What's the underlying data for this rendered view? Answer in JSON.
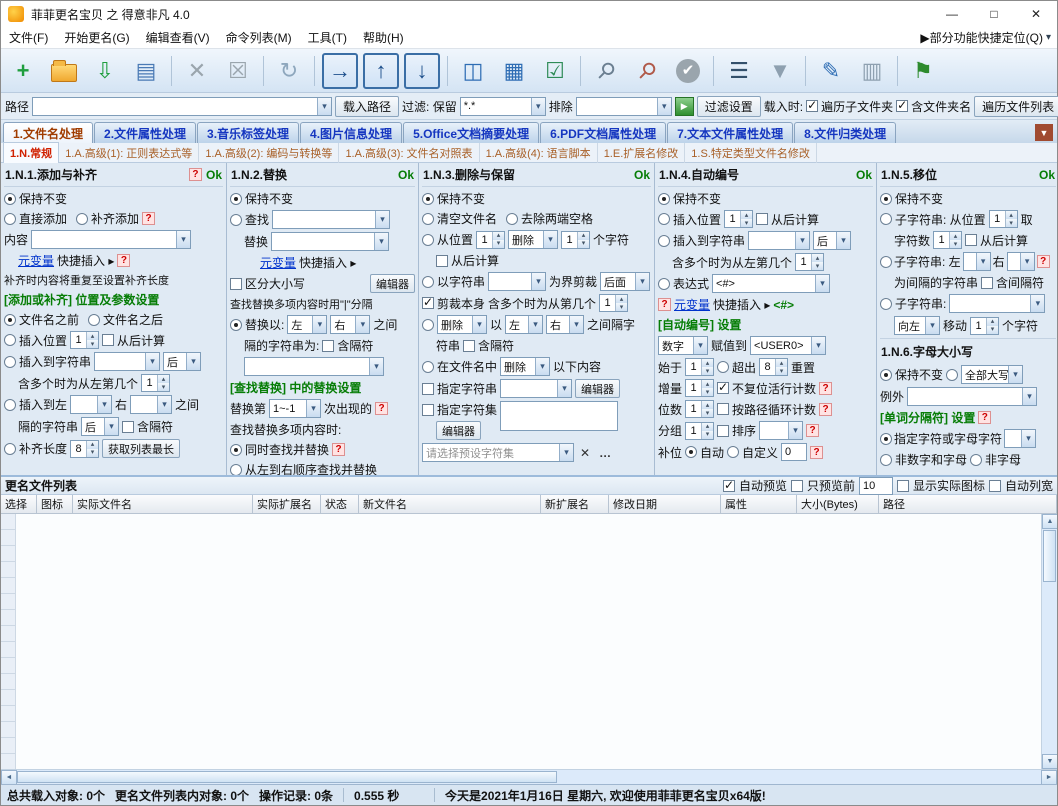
{
  "ui": {
    "q": "?",
    "ok": "Ok",
    "combo_arrow": "▾",
    "spin_up": "▴",
    "spin_down": "▾",
    "up": "▲",
    "down": "▼",
    "left": "◄",
    "right": "►"
  },
  "titlebar": {
    "title": "菲菲更名宝贝 之 得意非凡 4.0",
    "minimize": "—",
    "maximize": "□",
    "close": "✕"
  },
  "menubar": {
    "items": [
      "文件(F)",
      "开始更名(G)",
      "编辑查看(V)",
      "命令列表(M)",
      "工具(T)",
      "帮助(H)"
    ],
    "quick_locate": "▶部分功能快捷定位(Q)",
    "quick_locate_arrow": "▾"
  },
  "toolbar": {
    "icons": [
      {
        "name": "new-list-button",
        "glyph": "+",
        "color": "#1f9e3e",
        "bold": true
      },
      {
        "name": "open-folder-button",
        "shape": "folder"
      },
      {
        "name": "load-list-button",
        "glyph": "⇩",
        "color": "#1f9e3e"
      },
      {
        "name": "copy-list-button",
        "glyph": "▤",
        "color": "#4a7ab5"
      },
      {
        "name": "delete-item-button",
        "glyph": "✕",
        "color": "#9aa5ad",
        "sep_before": true
      },
      {
        "name": "clear-list-button",
        "glyph": "☒",
        "color": "#9aa5ad"
      },
      {
        "name": "refresh-button",
        "glyph": "↻",
        "color": "#8ea7bd",
        "sep_before": true
      },
      {
        "name": "move-right-button",
        "glyph": "→",
        "color": "#1d4f8c",
        "boxed": true,
        "sep_before": true
      },
      {
        "name": "move-up-button",
        "glyph": "↑",
        "color": "#1d4f8c",
        "boxed": true
      },
      {
        "name": "move-down-button",
        "glyph": "↓",
        "color": "#1d4f8c",
        "boxed": true
      },
      {
        "name": "split-view-button",
        "glyph": "◫",
        "color": "#2e6db4",
        "sep_before": true
      },
      {
        "name": "table-view-button",
        "glyph": "▦",
        "color": "#2e6db4"
      },
      {
        "name": "preview-list-button",
        "glyph": "☑",
        "color": "#2e8b57"
      },
      {
        "name": "search-button",
        "glyph": "⚲",
        "color": "#6b7f91",
        "rot": true,
        "sep_before": true
      },
      {
        "name": "search-replace-button",
        "glyph": "⚲",
        "color": "#b05a4a",
        "rot": true
      },
      {
        "name": "apply-rename-button",
        "glyph": "✔",
        "circle": true
      },
      {
        "name": "filter-options-button",
        "glyph": "☰",
        "color": "#33506b",
        "sep_before": true
      },
      {
        "name": "filter-funnel-button",
        "glyph": "▼",
        "color": "#8ea0b0"
      },
      {
        "name": "edit-list-button",
        "glyph": "✎",
        "color": "#2e6db4",
        "sep_before": true
      },
      {
        "name": "list-columns-button",
        "glyph": "▥",
        "color": "#8ea0b0"
      },
      {
        "name": "pin-button",
        "glyph": "⚑",
        "color": "#2e8b2e",
        "sep_before": true
      }
    ]
  },
  "pathbar": {
    "path_label": "路径",
    "path_value": "",
    "load_path_btn": "载入路径",
    "filter_label": "过滤: 保留",
    "keep_value": "*.*",
    "exclude_label": "排除",
    "exclude_value": "",
    "run_filter_btn": "▶",
    "filter_settings_btn": "过滤设置",
    "load_when_label": "载入时:",
    "recurse_cb": "遍历子文件夹",
    "include_folder_cb": "含文件夹名",
    "traverse_btn": "遍历文件列表"
  },
  "main_tabs": {
    "items": [
      "1.文件名处理",
      "2.文件属性处理",
      "3.音乐标签处理",
      "4.图片信息处理",
      "5.Office文档摘要处理",
      "6.PDF文档属性处理",
      "7.文本文件属性处理",
      "8.文件归类处理"
    ],
    "selected": 0,
    "more_arrow": "▼"
  },
  "sub_tabs": {
    "items": [
      "1.N.常规",
      "1.A.高级(1): 正则表达式等",
      "1.A.高级(2): 编码与转换等",
      "1.A.高级(3): 文件名对照表",
      "1.A.高级(4): 语言脚本",
      "1.E.扩展名修改",
      "1.S.特定类型文件名修改"
    ],
    "selected": 0
  },
  "p1": {
    "title": "1.N.1.添加与补齐",
    "keep": "保持不变",
    "direct_add": "直接添加",
    "pad_add": "补齐添加",
    "content_label": "内容",
    "var_link": "元变量",
    "var_rest": "快捷插入 ▸",
    "pad_note": "补齐时内容将重复至设置补齐长度",
    "pos_title": "[添加或补齐] 位置及参数设置",
    "before_name": "文件名之前",
    "after_name": "文件名之后",
    "insert_pos": "插入位置",
    "insert_pos_value": "1",
    "from_end": "从后计算",
    "insert_to_str": "插入到字符串",
    "after_opt": "后",
    "multi_label": "含多个时为从左第几个",
    "multi_value": "1",
    "insert_between": "插入到左",
    "right_label": "右",
    "between_suffix": "之间",
    "sep_label": "隔的字符串",
    "sep_side": "后",
    "include_sep": "含隔符",
    "pad_len_label": "补齐长度",
    "pad_len_value": "8",
    "get_longest_btn": "获取列表最长"
  },
  "p2": {
    "title": "1.N.2.替换",
    "keep": "保持不变",
    "find_label": "查找",
    "replace_label": "替换",
    "var_link": "元变量",
    "var_rest": "快捷插入 ▸",
    "case_cb": "区分大小写",
    "editor_btn": "编辑器",
    "multi_note": "查找替换多项内容时用\"|\"分隔",
    "replace_between": "替换以:",
    "left_opt": "左",
    "right_opt": "右",
    "between_suffix": "之间",
    "sep_label": "隔的字符串为:",
    "include_sep": "含隔符",
    "settings_title": "[查找替换] 中的替换设置",
    "occ_label": "替换第",
    "occ_value": "1~-1",
    "occ_suffix": "次出现的",
    "multi_mode_label": "查找替换多项内容时:",
    "simultaneous": "同时查找并替换",
    "sequential": "从左到右顺序查找并替换"
  },
  "p3": {
    "title": "1.N.3.删除与保留",
    "keep": "保持不变",
    "clear_name": "清空文件名",
    "trim": "去除两端空格",
    "from_pos": "从位置",
    "from_pos_value": "1",
    "del_opt": "删除",
    "count_value": "1",
    "chars_suffix": "个字符",
    "from_end": "从后计算",
    "by_str": "以字符串",
    "cut_label": "为界剪裁",
    "cut_side": "后面",
    "cut_self": "剪裁本身",
    "multi_label": "含多个时为从第几个",
    "multi_value": "1",
    "del2_opt": "删除",
    "with_label": "以",
    "left_opt": "左",
    "right_opt": "右",
    "between_suffix": "之间隔字",
    "sep_cont": "符串",
    "include_sep": "含隔符",
    "in_name": "在文件名中",
    "in_name_opt": "删除",
    "in_name_suffix": "以下内容",
    "spec_str_cb": "指定字符串",
    "editor_btn": "编辑器",
    "charset_cb": "指定字符集",
    "editor_btn2": "编辑器",
    "preset_placeholder": "请选择预设字符集",
    "clear_btn": "✕",
    "more_btn": "…"
  },
  "p4": {
    "title": "1.N.4.自动编号",
    "keep": "保持不变",
    "insert_pos": "插入位置",
    "insert_pos_value": "1",
    "from_end": "从后计算",
    "insert_to_str": "插入到字符串",
    "after_opt": "后",
    "multi_label": "含多个时为从左第几个",
    "multi_value": "1",
    "expr_label": "表达式",
    "expr_value": "<#>",
    "var_link": "元变量",
    "var_rest": "快捷插入 ▸",
    "var_tag": "<#>",
    "settings_title": "[自动编号] 设置",
    "type_value": "数字",
    "assign_label": "赋值到",
    "assign_value": "<USER0>",
    "start_label": "始于",
    "start_value": "1",
    "over_label": "超出",
    "over_value": "8",
    "reset_suffix": "重置",
    "inc_label": "增量",
    "inc_value": "1",
    "no_reset_cb": "不复位活行计数",
    "digits_label": "位数",
    "digits_value": "1",
    "per_path_cb": "按路径循环计数",
    "group_label": "分组",
    "group_value": "1",
    "sort_cb": "排序",
    "pad_label": "补位",
    "auto_opt": "自动",
    "custom_opt": "自定义",
    "custom_value": "0"
  },
  "p5": {
    "title": "1.N.5.移位",
    "keep": "保持不变",
    "sub1": "子字符串: 从位置",
    "sub1_value": "1",
    "take_suffix": "取",
    "count_label": "字符数",
    "count_value": "1",
    "from_end": "从后计算",
    "sub2": "子字符串: 左",
    "right_label": "右",
    "sep_note": "为间隔的字符串",
    "include_sep": "含间隔符",
    "sub3": "子字符串:",
    "dir_value": "向左",
    "move_label": "移动",
    "move_value": "1",
    "move_suffix": "个字符",
    "case_title": "1.N.6.字母大小写",
    "case_keep": "保持不变",
    "case_opt": "全部大写",
    "except_label": "例外",
    "wordsep_title": "[单词分隔符] 设置",
    "spec_chars": "指定字符或字母字符",
    "non_alnum": "非数字和字母",
    "non_alpha": "非字母"
  },
  "filelist": {
    "title": "更名文件列表",
    "auto_preview_cb": "自动预览",
    "preview_first_cb": "只预览前",
    "preview_count": "10",
    "show_icons_cb": "显示实际图标",
    "auto_width_cb": "自动列宽",
    "columns": [
      "选择",
      "图标",
      "实际文件名",
      "实际扩展名",
      "状态",
      "新文件名",
      "新扩展名",
      "修改日期",
      "属性",
      "大小(Bytes)",
      "路径"
    ]
  },
  "statusbar": {
    "loaded": "总共载入对象: 0个",
    "in_list": "更名文件列表内对象: 0个",
    "records": "操作记录: 0条",
    "time": "0.555 秒",
    "welcome": "今天是2021年1月16日 星期六, 欢迎使用菲菲更名宝贝x64版!"
  }
}
